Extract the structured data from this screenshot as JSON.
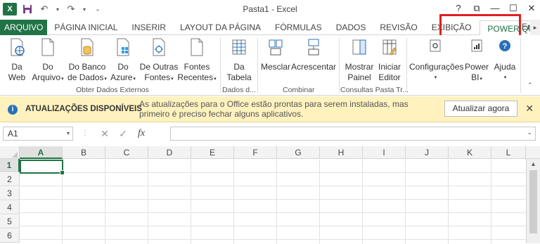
{
  "window": {
    "title": "Pasta1 - Excel",
    "app_icon": "X",
    "controls": [
      "?",
      "⧉",
      "—",
      "☐",
      "✕"
    ]
  },
  "tabs": [
    {
      "label": "ARQUIVO"
    },
    {
      "label": "PÁGINA INICIAL"
    },
    {
      "label": "INSERIR"
    },
    {
      "label": "LAYOUT DA PÁGINA"
    },
    {
      "label": "FÓRMULAS"
    },
    {
      "label": "DADOS"
    },
    {
      "label": "REVISÃO"
    },
    {
      "label": "EXIBIÇÃO"
    },
    {
      "label": "POWER QUERY"
    }
  ],
  "tab_overflow": "Er",
  "ribbon": {
    "obter": {
      "label": "Obter Dados Externos",
      "buttons": [
        {
          "line1": "Da",
          "line2": "Web"
        },
        {
          "line1": "Do",
          "line2": "Arquivo"
        },
        {
          "line1": "Do Banco",
          "line2": "de Dados"
        },
        {
          "line1": "Do",
          "line2": "Azure"
        },
        {
          "line1": "De Outras",
          "line2": "Fontes"
        },
        {
          "line1": "Fontes",
          "line2": "Recentes"
        }
      ]
    },
    "dados": {
      "label": "Dados d...",
      "buttons": [
        {
          "line1": "Da",
          "line2": "Tabela"
        }
      ]
    },
    "combinar": {
      "label": "Combinar",
      "buttons": [
        {
          "line1": "Mesclar",
          "line2": ""
        },
        {
          "line1": "Acrescentar",
          "line2": ""
        }
      ]
    },
    "consultas": {
      "label": "Consultas Pasta Tr...",
      "buttons": [
        {
          "line1": "Mostrar",
          "line2": "Painel"
        },
        {
          "line1": "Iniciar",
          "line2": "Editor"
        }
      ]
    },
    "extras": {
      "buttons": [
        {
          "line1": "Configurações",
          "line2": ""
        },
        {
          "line1": "Power",
          "line2": "BI"
        },
        {
          "line1": "Ajuda",
          "line2": ""
        }
      ]
    }
  },
  "notification": {
    "title": "ATUALIZAÇÕES DISPONÍVEIS",
    "message": "As atualizações para o Office estão prontas para serem instaladas, mas primeiro é preciso fechar alguns aplicativos.",
    "button": "Atualizar agora",
    "close": "✕"
  },
  "formula_bar": {
    "name_box": "A1",
    "cancel": "✕",
    "enter": "✓",
    "fx": "fx",
    "value": ""
  },
  "grid": {
    "columns": [
      "A",
      "B",
      "C",
      "D",
      "E",
      "F",
      "G",
      "H",
      "I",
      "J",
      "K",
      "L"
    ],
    "rows": [
      "1",
      "2",
      "3",
      "4",
      "5",
      "6"
    ],
    "active_cell": "A1"
  },
  "colors": {
    "excel_green": "#217346",
    "highlight_red": "#e02020",
    "notification_bg": "#fff2bf"
  }
}
